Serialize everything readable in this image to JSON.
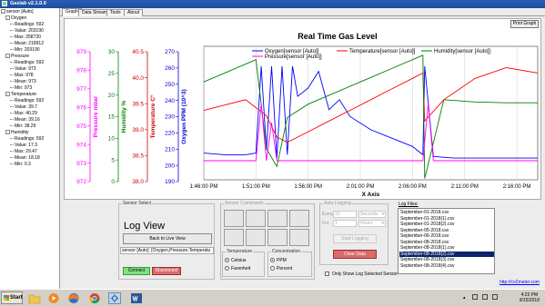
{
  "window": {
    "title": "Gaslab v2.1.0.0"
  },
  "tree": [
    {
      "label": "sensor [Auto]",
      "level": 0,
      "expander": "⊟"
    },
    {
      "label": "Oxygen",
      "level": 1,
      "expander": "⊟"
    },
    {
      "label": "Readings: 592",
      "level": 2
    },
    {
      "label": "Value: 203190",
      "level": 2
    },
    {
      "label": "Max: 258720",
      "level": 2
    },
    {
      "label": "Mean: 218912",
      "level": 2
    },
    {
      "label": "Min: 203190",
      "level": 2
    },
    {
      "label": "Pressure",
      "level": 1,
      "expander": "⊟"
    },
    {
      "label": "Readings: 592",
      "level": 2
    },
    {
      "label": "Value: 973",
      "level": 2
    },
    {
      "label": "Max: 978",
      "level": 2
    },
    {
      "label": "Mean: 973",
      "level": 2
    },
    {
      "label": "Min: 973",
      "level": 2
    },
    {
      "label": "Temperature",
      "level": 1,
      "expander": "⊟"
    },
    {
      "label": "Readings: 592",
      "level": 2
    },
    {
      "label": "Value: 39.7",
      "level": 2
    },
    {
      "label": "Max: 40.29",
      "level": 2
    },
    {
      "label": "Mean: 39.16",
      "level": 2
    },
    {
      "label": "Min: 38.29",
      "level": 2
    },
    {
      "label": "Humidity",
      "level": 1,
      "expander": "⊟"
    },
    {
      "label": "Readings: 592",
      "level": 2
    },
    {
      "label": "Value: 17.3",
      "level": 2
    },
    {
      "label": "Max: 29.47",
      "level": 2
    },
    {
      "label": "Mean: 18.18",
      "level": 2
    },
    {
      "label": "Min: 0.3",
      "level": 2
    }
  ],
  "tabs": [
    "Graph",
    "Data Stream",
    "Tools",
    "About"
  ],
  "graph": {
    "print_label": "Print Graph"
  },
  "chart_data": {
    "type": "line",
    "title": "Real Time Gas Level",
    "xlabel": "X Axis",
    "x_ticks": [
      "1:46:00 PM",
      "1:51:00 PM",
      "1:56:00 PM",
      "2:01:00 PM",
      "2:06:00 PM",
      "2:11:00 PM",
      "2:16:00 PM"
    ],
    "x_range": [
      "1:46:00 PM",
      "2:18:00 PM"
    ],
    "grid": true,
    "legend_position": "top",
    "axes": [
      {
        "label": "Pressure mbar",
        "color": "#ff00ff",
        "ticks": [
          972,
          973,
          974,
          975,
          976,
          977,
          978,
          979
        ],
        "range": [
          972,
          979
        ]
      },
      {
        "label": "Humidity %",
        "color": "#008000",
        "ticks": [
          0,
          5,
          10,
          15,
          20,
          25,
          30
        ],
        "range": [
          0,
          30
        ]
      },
      {
        "label": "Temperature C°",
        "color": "#cc0000",
        "ticks": [
          38.0,
          38.5,
          39.0,
          39.5,
          40.0,
          40.5
        ],
        "range": [
          38.0,
          40.5
        ]
      },
      {
        "label": "Oxygen PPM (10^3)",
        "color": "#0000cc",
        "ticks": [
          190,
          200,
          210,
          220,
          230,
          240,
          250,
          260,
          270
        ],
        "range": [
          190,
          270
        ]
      }
    ],
    "series": [
      {
        "name": "Oxygen[sensor [Auto]]",
        "color": "#0000ff",
        "axis": 3,
        "x": [
          "1:46:00 PM",
          "1:48:00 PM",
          "1:50:00 PM",
          "1:51:00 PM",
          "1:51:30 PM",
          "1:52:00 PM",
          "1:52:30 PM",
          "1:53:00 PM",
          "1:53:30 PM",
          "1:54:00 PM",
          "1:54:30 PM",
          "1:55:00 PM",
          "1:56:00 PM",
          "1:57:00 PM",
          "1:58:00 PM",
          "1:59:00 PM",
          "2:00:00 PM",
          "2:02:00 PM",
          "2:04:00 PM",
          "2:06:00 PM",
          "2:07:00 PM",
          "2:07:10 PM",
          "2:08:00 PM",
          "2:10:00 PM",
          "2:12:00 PM",
          "2:14:00 PM",
          "2:16:00 PM",
          "2:18:00 PM"
        ],
        "y": [
          206,
          205,
          205,
          206,
          258,
          208,
          258,
          203,
          258,
          205,
          258,
          240,
          245,
          255,
          232,
          238,
          228,
          220,
          215,
          210,
          205,
          258,
          204,
          203,
          203,
          203,
          203,
          203
        ]
      },
      {
        "name": "Temperature[sensor [Auto]]",
        "color": "#ff0000",
        "axis": 2,
        "x": [
          "1:46:00 PM",
          "1:48:00 PM",
          "1:50:00 PM",
          "1:52:00 PM",
          "1:53:00 PM",
          "1:54:00 PM",
          "1:56:00 PM",
          "1:58:00 PM",
          "2:00:00 PM",
          "2:02:00 PM",
          "2:04:00 PM",
          "2:06:00 PM",
          "2:07:00 PM",
          "2:07:10 PM",
          "2:09:00 PM",
          "2:12:00 PM",
          "2:15:00 PM",
          "2:18:00 PM"
        ],
        "y": [
          39.3,
          39.4,
          39.5,
          39.2,
          38.8,
          38.7,
          38.9,
          39.1,
          39.3,
          39.5,
          39.7,
          39.9,
          40.0,
          39.1,
          39.5,
          39.9,
          40.1,
          40.0
        ]
      },
      {
        "name": "Humidity[sensor [Auto]]",
        "color": "#008000",
        "axis": 1,
        "x": [
          "1:46:00 PM",
          "1:48:00 PM",
          "1:50:00 PM",
          "1:51:00 PM",
          "1:52:00 PM",
          "1:53:00 PM",
          "1:54:00 PM",
          "1:56:00 PM",
          "1:58:00 PM",
          "2:00:00 PM",
          "2:02:00 PM",
          "2:04:00 PM",
          "2:06:00 PM",
          "2:07:00 PM",
          "2:07:10 PM",
          "2:09:00 PM",
          "2:12:00 PM",
          "2:15:00 PM",
          "2:18:00 PM"
        ],
        "y": [
          22,
          24,
          26,
          27,
          7,
          3,
          14,
          17,
          19,
          21,
          23,
          25,
          27,
          28,
          0.3,
          18,
          17.5,
          17.3,
          17.3
        ]
      },
      {
        "name": "Pressure[sensor [Auto]]",
        "color": "#ff00ff",
        "axis": 0,
        "x": [
          "1:46:00 PM",
          "1:48:00 PM",
          "1:50:00 PM",
          "1:51:00 PM",
          "1:51:30 PM",
          "1:52:00 PM",
          "1:52:30 PM",
          "1:53:00 PM",
          "1:56:00 PM",
          "2:00:00 PM",
          "2:04:00 PM",
          "2:07:00 PM",
          "2:07:30 PM",
          "2:08:00 PM",
          "2:12:00 PM",
          "2:18:00 PM"
        ],
        "y": [
          973,
          973,
          973,
          973,
          976,
          973,
          975,
          973,
          973,
          973,
          973,
          973,
          976,
          973,
          973,
          973
        ]
      }
    ]
  },
  "sensor_select": {
    "group_label": "Sensor Select",
    "title": "Log View",
    "back_button": "Back to Live View",
    "sensor_field": "sensor [Auto]: [Oxygen,Pressure,Temperatu",
    "connect": "Connect",
    "disconnect": "Disconnect"
  },
  "sensor_commands": {
    "group_label": "Sensor Commands"
  },
  "temperature_group": {
    "label": "Temperature",
    "options": [
      "Celsius",
      "Farenheit"
    ],
    "selected": "Celsius"
  },
  "concentration_group": {
    "label": "Concentration",
    "options": [
      "PPM",
      "Percent"
    ],
    "selected": "PPM"
  },
  "auto_logging": {
    "group_label": "Auto Logging",
    "every_label": "Every",
    "every_value": "10",
    "every_unit": "Seconds",
    "for_label": "For",
    "for_value": "1",
    "for_unit": "Hours",
    "start_button": "Start Logging",
    "clear_button": "Clear Data"
  },
  "log_files": {
    "label": "Log Files:",
    "items": [
      "September-01-2018.csv",
      "September-01-2018(1).csv",
      "September-01-2018(2).csv",
      "September-05-2018.csv",
      "September-06-2018.csv",
      "September-08-2018.csv",
      "September-08-2018(1).csv",
      "September-08-2018(2).csv",
      "September-08-2018(3).csv",
      "September-08-2018(4).csv"
    ],
    "selected_index": 7,
    "show_selected_label": "Only Show Log Selected Sensor",
    "website": "http://co2meter.com"
  },
  "taskbar": {
    "start_label": "Start",
    "time": "4:23 PM",
    "date": "9/15/2018",
    "icons": [
      "folder-icon",
      "media-player-icon",
      "firefox-icon",
      "chrome-icon",
      "gaslab-icon",
      "word-icon"
    ]
  }
}
